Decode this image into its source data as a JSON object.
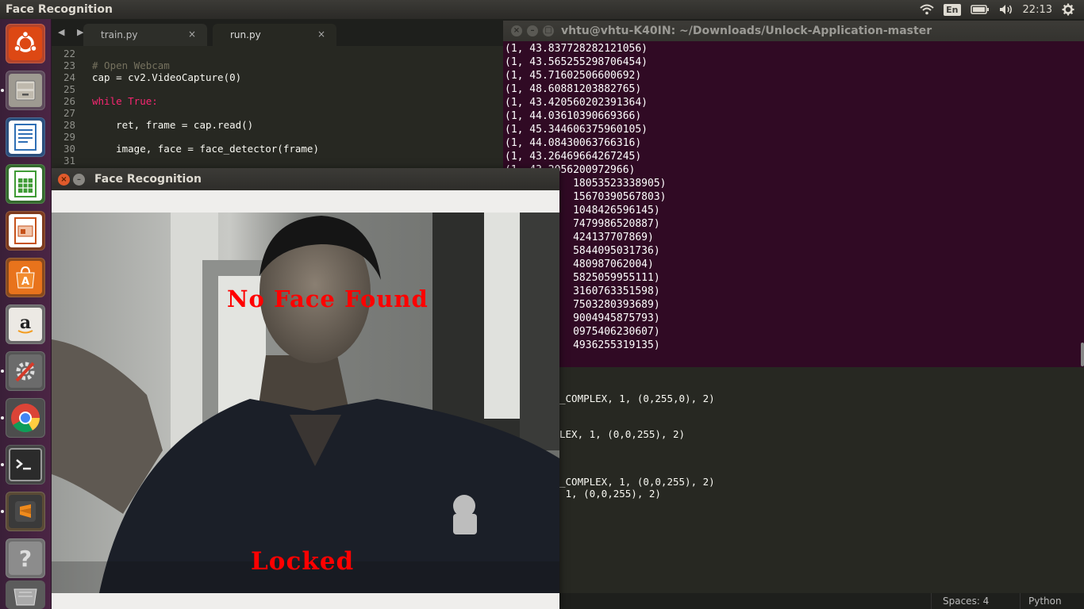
{
  "top_panel": {
    "app_title": "Face Recognition",
    "keyboard_layout": "En",
    "clock": "22:13"
  },
  "launcher": {
    "items": [
      {
        "name": "ubuntu-dash",
        "icon": "ubuntu-logo-icon",
        "color": "#dd4814"
      },
      {
        "name": "files",
        "icon": "file-cabinet-icon",
        "color": "#9e9a91"
      },
      {
        "name": "libreoffice-writer",
        "icon": "document-icon",
        "color": "#2f6fb5"
      },
      {
        "name": "libreoffice-calc",
        "icon": "spreadsheet-icon",
        "color": "#3f9b35"
      },
      {
        "name": "libreoffice-impress",
        "icon": "presentation-icon",
        "color": "#c6521b"
      },
      {
        "name": "software-center",
        "icon": "shopping-bag-icon",
        "color": "#e8731c"
      },
      {
        "name": "amazon",
        "icon": "amazon-icon",
        "color": "#ece9e4"
      },
      {
        "name": "system-settings",
        "icon": "gear-wrench-icon",
        "color": "#6b6b6b"
      },
      {
        "name": "chrome",
        "icon": "chrome-icon",
        "color": "#e0e0e0"
      },
      {
        "name": "terminal",
        "icon": "terminal-icon",
        "color": "#3a3a3a"
      },
      {
        "name": "sublime-text",
        "icon": "sublime-icon",
        "color": "#ef8a1c"
      },
      {
        "name": "help",
        "icon": "question-icon",
        "color": "#8c8c8c"
      }
    ]
  },
  "editor": {
    "tabs": [
      {
        "label": "train.py",
        "close": "×",
        "active": false
      },
      {
        "label": "run.py",
        "close": "×",
        "active": true
      }
    ],
    "nav": "◀ ▶",
    "lines": [
      {
        "num": "22",
        "text": ""
      },
      {
        "num": "23",
        "text": "# Open Webcam"
      },
      {
        "num": "24",
        "text": "cap = cv2.VideoCapture(0)"
      },
      {
        "num": "25",
        "text": ""
      },
      {
        "num": "26",
        "text": "while True:"
      },
      {
        "num": "27",
        "text": ""
      },
      {
        "num": "28",
        "text": "    ret, frame = cap.read()"
      },
      {
        "num": "29",
        "text": ""
      },
      {
        "num": "30",
        "text": "    image, face = face_detector(frame)"
      },
      {
        "num": "31",
        "text": ""
      }
    ],
    "partial_lines": [
      "_COMPLEX, 1, (0,255,0), 2)",
      "LEX, 1, (0,0,255), 2)",
      "_COMPLEX, 1, (0,0,255), 2)",
      " 1, (0,0,255), 2)"
    ],
    "status": {
      "spaces": "Spaces: 4",
      "syntax": "Python"
    }
  },
  "terminal": {
    "title": "vhtu@vhtu-K40IN: ~/Downloads/Unlock-Application-master",
    "lines": [
      "(1, 43.837728282121056)",
      "(1, 43.565255298706454)",
      "(1, 45.71602506600692)",
      "(1, 48.60881203882765)",
      "(1, 43.420560202391364)",
      "(1, 44.03610390669366)",
      "(1, 45.344606375960105)",
      "(1, 44.08430063766316)",
      "(1, 43.26469664267245)",
      "(1, 43.2056200972966)",
      "           18053523338905)",
      "           15670390567803)",
      "           1048426596145)",
      "           7479986520887)",
      "           424137707869)",
      "           5844095031736)",
      "           480987062004)",
      "           5825059955111)",
      "           3160763351598)",
      "           7503280393689)",
      "           9004945875793)",
      "           0975406230607)",
      "           4936255319135)"
    ]
  },
  "face_window": {
    "title": "Face Recognition",
    "overlay_top": "No Face Found",
    "overlay_bottom": "Locked"
  }
}
